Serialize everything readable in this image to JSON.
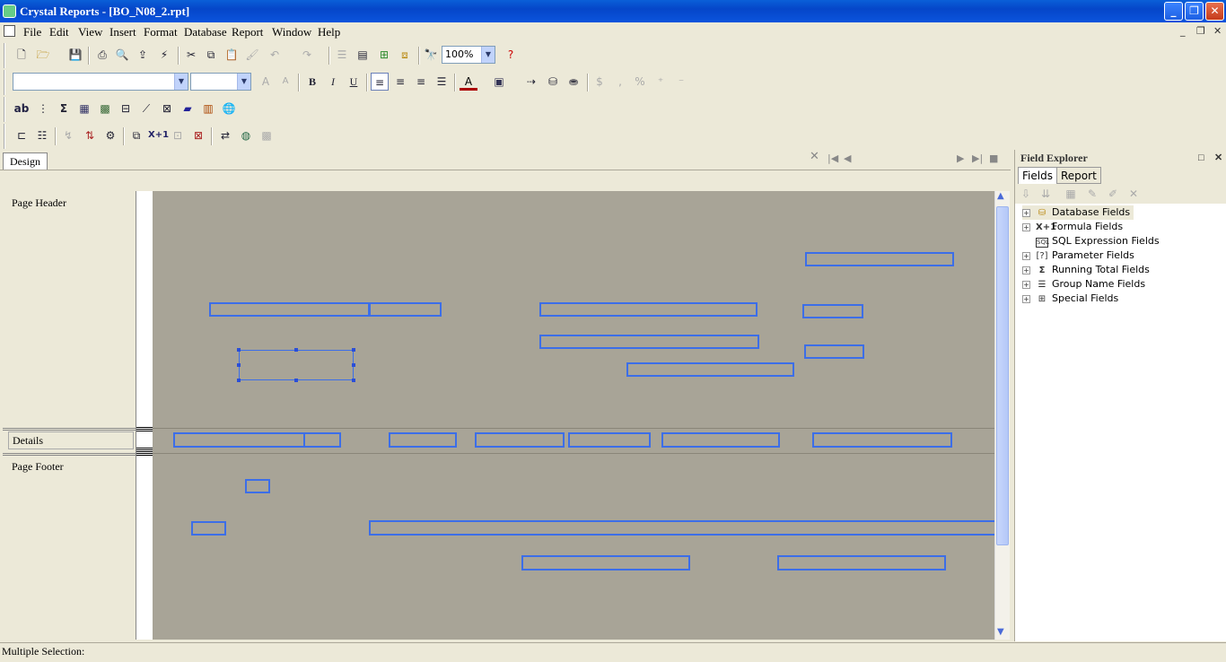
{
  "window": {
    "title": "Crystal Reports - [BO_N08_2.rpt]"
  },
  "menu": [
    "File",
    "Edit",
    "View",
    "Insert",
    "Format",
    "Database",
    "Report",
    "Window",
    "Help"
  ],
  "toolbar": {
    "zoom": "100%",
    "font_name": "",
    "font_size": ""
  },
  "design_tab": "Design",
  "sections": {
    "page_header": "Page Header",
    "details": "Details",
    "page_footer": "Page Footer"
  },
  "field_explorer": {
    "title": "Field Explorer",
    "tabs": [
      "Fields",
      "Report"
    ],
    "items": [
      "Database Fields",
      "Formula Fields",
      "SQL Expression Fields",
      "Parameter Fields",
      "Running Total Fields",
      "Group Name Fields",
      "Special Fields"
    ]
  },
  "status": "Multiple Selection:"
}
